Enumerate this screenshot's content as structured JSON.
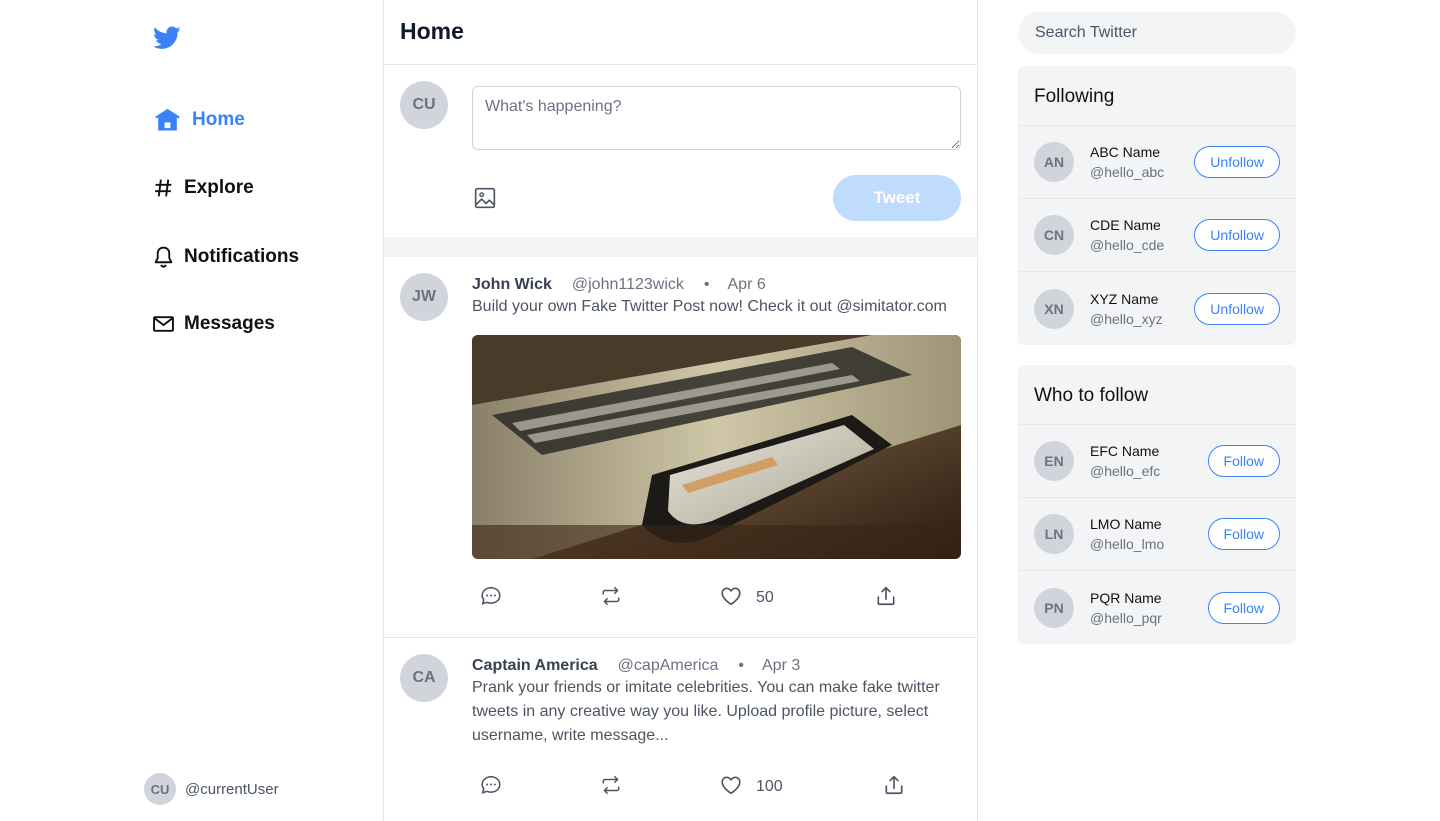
{
  "nav": {
    "items": [
      {
        "label": "Home",
        "icon": "home-icon"
      },
      {
        "label": "Explore",
        "icon": "hash-icon"
      },
      {
        "label": "Notifications",
        "icon": "bell-icon"
      },
      {
        "label": "Messages",
        "icon": "mail-icon"
      }
    ],
    "active": "Home",
    "accent": "#3b82f6"
  },
  "current_user": {
    "initials": "CU",
    "handle": "@currentUser"
  },
  "main": {
    "title": "Home",
    "composer": {
      "avatar_initials": "CU",
      "placeholder": "What's happening?",
      "tweet_label": "Tweet"
    },
    "tweets": [
      {
        "initials": "JW",
        "name": "John Wick",
        "handle": "@john1123wick",
        "dot": "•",
        "date": "Apr 6",
        "text": "Build your own Fake Twitter Post now! Check it out @simitator.com",
        "likes": "50"
      },
      {
        "initials": "CA",
        "name": "Captain America",
        "handle": "@capAmerica",
        "dot": "•",
        "date": "Apr 3",
        "text": "Prank your friends or imitate celebrities. You can make fake twitter tweets in any creative way you like. Upload profile picture, select username, write message...",
        "likes": "100"
      }
    ]
  },
  "sidebar_right": {
    "search_placeholder": "Search Twitter",
    "following": {
      "title": "Following",
      "users": [
        {
          "initials": "AN",
          "name": "ABC Name",
          "handle": "@hello_abc",
          "action": "Unfollow"
        },
        {
          "initials": "CN",
          "name": "CDE Name",
          "handle": "@hello_cde",
          "action": "Unfollow"
        },
        {
          "initials": "XN",
          "name": "XYZ Name",
          "handle": "@hello_xyz",
          "action": "Unfollow"
        }
      ]
    },
    "who_to_follow": {
      "title": "Who to follow",
      "users": [
        {
          "initials": "EN",
          "name": "EFC Name",
          "handle": "@hello_efc",
          "action": "Follow"
        },
        {
          "initials": "LN",
          "name": "LMO Name",
          "handle": "@hello_lmo",
          "action": "Follow"
        },
        {
          "initials": "PN",
          "name": "PQR Name",
          "handle": "@hello_pqr",
          "action": "Follow"
        }
      ]
    }
  }
}
